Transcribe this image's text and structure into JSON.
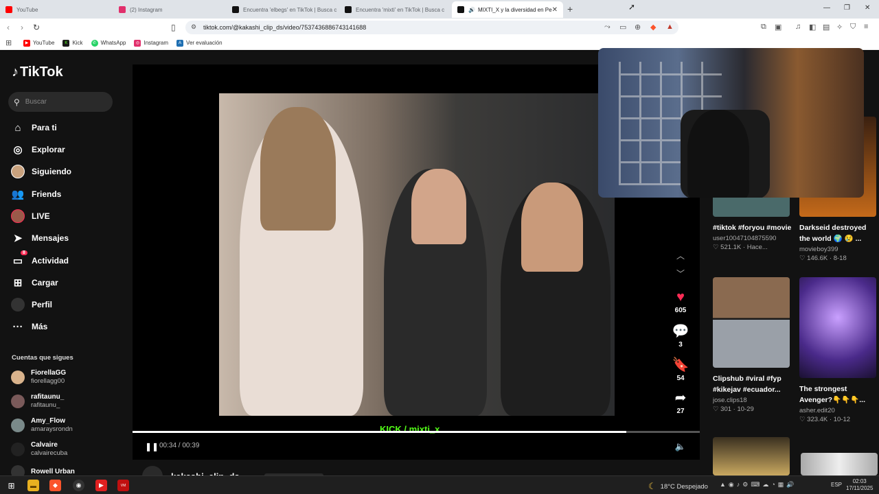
{
  "browser": {
    "tabs": [
      {
        "label": "YouTube",
        "color": "#ff0000",
        "active": false
      },
      {
        "label": "(2) Instagram",
        "color": "#e1306c",
        "active": false
      },
      {
        "label": "Encuentra 'elbegs' en TikTok | Busca c",
        "color": "#111111",
        "active": false
      },
      {
        "label": "Encuentra 'mixti' en TikTok | Busca c",
        "color": "#111111",
        "active": false
      },
      {
        "label": "MIXTI_X y la diversidad en Pe",
        "color": "#111111",
        "active": true
      }
    ],
    "url": "tiktok.com/@kakashi_clip_ds/video/7537436886743141688",
    "bookmarks": [
      {
        "label": "YouTube",
        "color": "#ff0000"
      },
      {
        "label": "Kick",
        "color": "#1a1a1a"
      },
      {
        "label": "WhatsApp",
        "color": "#25d366"
      },
      {
        "label": "Instagram",
        "color": "#e1306c"
      },
      {
        "label": "Ver evaluación",
        "color": "#1f6fb2"
      }
    ]
  },
  "sidebar": {
    "logo": "TikTok",
    "search_placeholder": "Buscar",
    "nav": [
      {
        "label": "Para ti",
        "icon": "home-icon"
      },
      {
        "label": "Explorar",
        "icon": "compass-icon"
      },
      {
        "label": "Siguiendo",
        "icon": "avatar"
      },
      {
        "label": "Friends",
        "icon": "friends-icon"
      },
      {
        "label": "LIVE",
        "icon": "avatar"
      },
      {
        "label": "Mensajes",
        "icon": "send-icon"
      },
      {
        "label": "Actividad",
        "icon": "inbox-icon",
        "badge": "8"
      },
      {
        "label": "Cargar",
        "icon": "plus-icon"
      },
      {
        "label": "Perfil",
        "icon": "avatar"
      },
      {
        "label": "Más",
        "icon": "more-icon"
      }
    ],
    "following_title": "Cuentas que sigues",
    "accounts": [
      {
        "name": "FiorellaGG",
        "handle": "fiorellagg00",
        "color": "#d9b38c"
      },
      {
        "name": "rafitaunu_",
        "handle": "rafitaunu_",
        "color": "#7a5a5a"
      },
      {
        "name": "Amy_Flow",
        "handle": "amaraysrondn",
        "color": "#7a8a8a"
      },
      {
        "name": "Calvaire",
        "handle": "calvairecuba",
        "color": "#222222"
      },
      {
        "name": "Rowell Urban",
        "handle": "",
        "color": "#333333"
      }
    ]
  },
  "video": {
    "overlay_label": "KICK / mixti_x",
    "time": "00:34 / 00:39",
    "progress": 0.87,
    "author": "kakashi_clip_ds"
  },
  "actions": {
    "likes": "605",
    "comments": "3",
    "saves": "54",
    "shares": "27"
  },
  "suggestions": [
    {
      "title": "#tiktok #foryou #movie",
      "author": "user10047104875590",
      "meta": "521.1K · Hace...",
      "color": "#4a6a6a"
    },
    {
      "title": "Darkseid destroyed the world 🌍 😢 ...",
      "author": "movieboy399",
      "meta": "146.6K · 8-18",
      "color": "#8a4a20"
    },
    {
      "title": "Clipshub #viral #fyp #kikejav #ecuador...",
      "author": "jose.clips18",
      "meta": "301 · 10-29",
      "color": "#8a6a50"
    },
    {
      "title": "The strongest Avenger?👇👇👇...",
      "author": "asher.edit20",
      "meta": "323.4K · 10-12",
      "color": "#6a4a9a"
    }
  ],
  "taskbar": {
    "weather": "18°C Despejado",
    "lang": "ESP",
    "time": "02:03",
    "date": "17/11/2025"
  }
}
